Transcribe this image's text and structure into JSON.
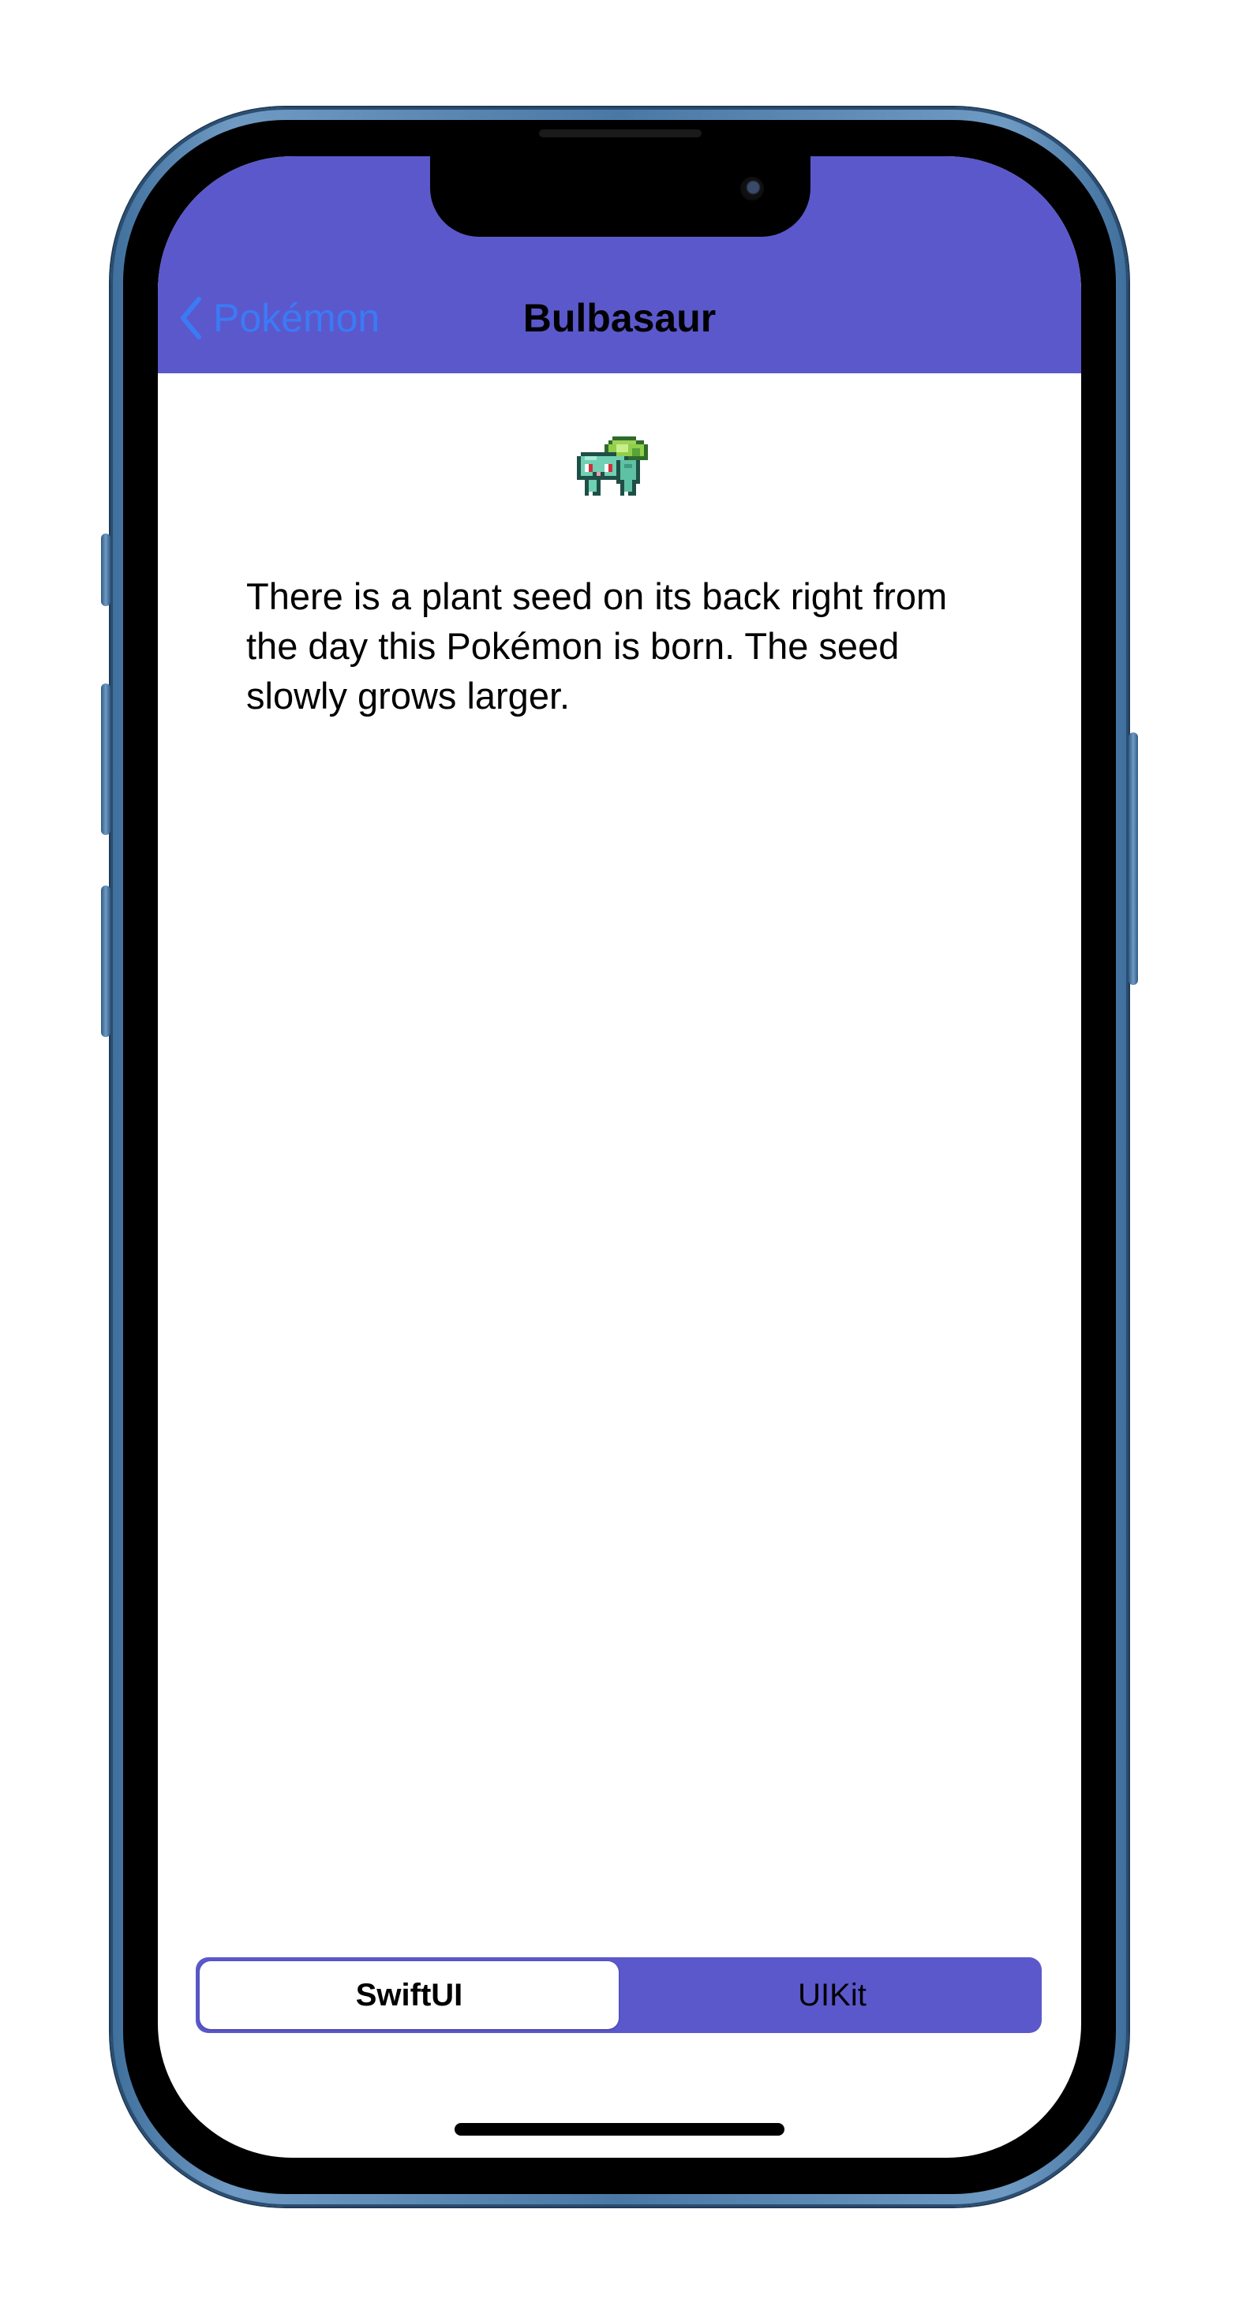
{
  "nav": {
    "back_label": "Pokémon",
    "title": "Bulbasaur"
  },
  "content": {
    "sprite_icon": "bulbasaur-sprite",
    "description": "There is a plant seed on its back right from the day this Pokémon is born. The seed slowly grows larger."
  },
  "segmented_control": {
    "options": [
      "SwiftUI",
      "UIKit"
    ],
    "selected": "SwiftUI"
  },
  "colors": {
    "accent": "#5b58cc",
    "back_tint": "#3a7bf5"
  }
}
